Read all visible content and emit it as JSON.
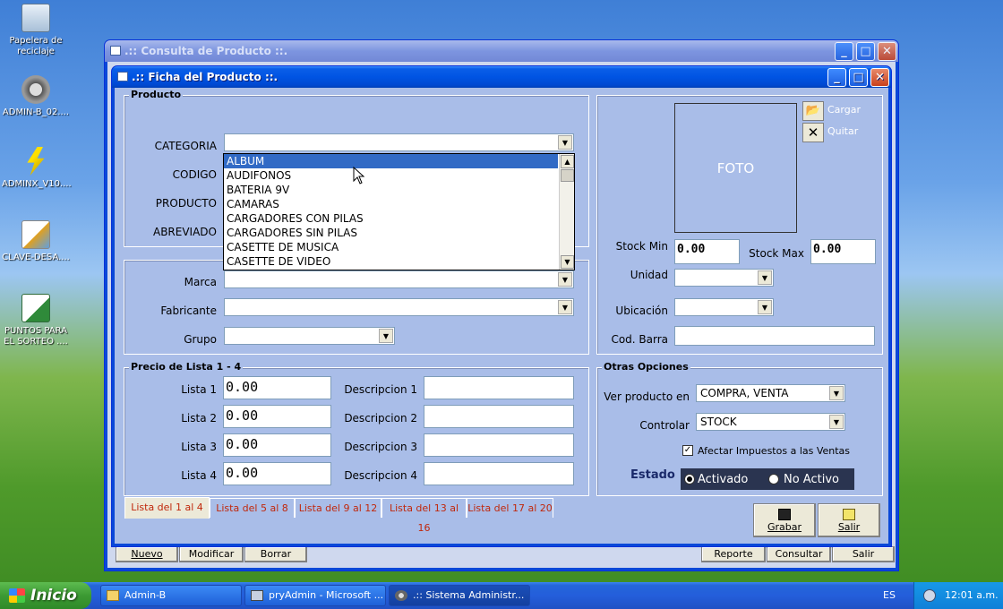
{
  "desktop": {
    "icons": [
      {
        "label": "Papelera de reciclaje"
      },
      {
        "label": "ADMIN-B_02...."
      },
      {
        "label": "ADMINX_V10...."
      },
      {
        "label": "CLAVE-DESA...."
      },
      {
        "label": "PUNTOS PARA EL SORTEO ...."
      }
    ]
  },
  "outer_window": {
    "title": ".:: Consulta de Producto ::.",
    "buttons": {
      "nuevo": "Nuevo",
      "modificar": "Modificar",
      "borrar": "Borrar",
      "reporte": "Reporte",
      "consultar": "Consultar",
      "salir": "Salir"
    }
  },
  "inner_window": {
    "title": ".:: Ficha del Producto ::.",
    "producto_group": {
      "title": "Producto",
      "categoria_label": "CATEGORIA",
      "codigo_label": "CODIGO",
      "producto_label": "PRODUCTO",
      "abreviado_label": "ABREVIADO"
    },
    "categoria_dropdown": [
      "ALBUM",
      "AUDIFONOS",
      "BATERIA 9V",
      "CAMARAS",
      "CARGADORES CON PILAS",
      "CARGADORES SIN PILAS",
      "CASETTE DE MUSICA",
      "CASETTE DE VIDEO"
    ],
    "marca_label": "Marca",
    "fabricante_label": "Fabricante",
    "grupo_label": "Grupo",
    "foto": {
      "placeholder": "FOTO",
      "cargar": "Cargar",
      "quitar": "Quitar"
    },
    "stock_min_label": "Stock Min",
    "stock_min_value": "0.00",
    "stock_max_label": "Stock Max",
    "stock_max_value": "0.00",
    "unidad_label": "Unidad",
    "ubicacion_label": "Ubicación",
    "cod_barra_label": "Cod. Barra",
    "precio_group": {
      "title": "Precio de Lista 1 - 4",
      "rows": [
        {
          "label": "Lista 1",
          "value": "0.00",
          "desc_label": "Descripcion 1"
        },
        {
          "label": "Lista 2",
          "value": "0.00",
          "desc_label": "Descripcion 2"
        },
        {
          "label": "Lista 3",
          "value": "0.00",
          "desc_label": "Descripcion 3"
        },
        {
          "label": "Lista 4",
          "value": "0.00",
          "desc_label": "Descripcion 4"
        }
      ]
    },
    "tabs": [
      "Lista del 1 al 4",
      "Lista del 5 al 8",
      "Lista del 9 al 12",
      "Lista del 13 al 16",
      "Lista del 17 al 20"
    ],
    "otras_opciones": {
      "title": "Otras Opciones",
      "ver_producto_label": "Ver producto en",
      "ver_producto_value": "COMPRA, VENTA",
      "controlar_label": "Controlar",
      "controlar_value": "STOCK",
      "afectar_label": "Afectar Impuestos a las Ventas",
      "estado_label": "Estado",
      "activado": "Activado",
      "no_activo": "No Activo"
    },
    "grabar": "Grabar",
    "salir": "Salir"
  },
  "taskbar": {
    "start": "Inicio",
    "tasks": [
      "Admin-B",
      "pryAdmin - Microsoft ...",
      ".:: Sistema Administr..."
    ],
    "lang": "ES",
    "clock": "12:01 a.m."
  }
}
